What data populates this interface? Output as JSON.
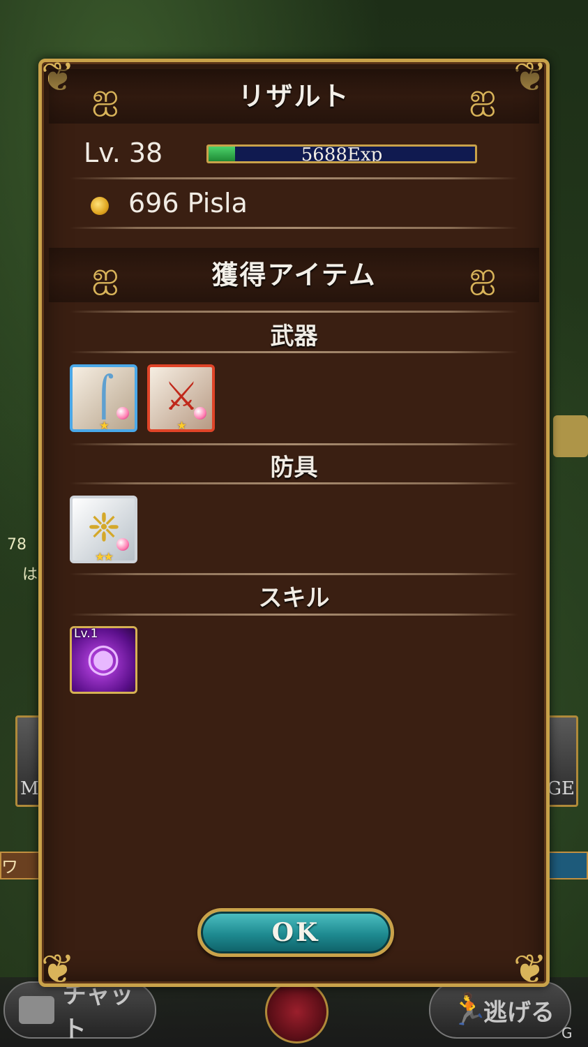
{
  "background": {
    "left_hp_value": "78",
    "left_hp_char": "は",
    "left_side_text": "M",
    "right_side_text": "GE",
    "left_bar_text": "ワ"
  },
  "dialog": {
    "title": "リザルト",
    "level_label": "Lv. 38",
    "exp_text": "5688Exp",
    "exp_progress_fraction": 0.1,
    "currency_text": "696 Pisla",
    "items_header": "獲得アイテム",
    "sections": {
      "weapons": "武器",
      "armor": "防具",
      "skills": "スキル"
    },
    "skill_tile_level": "Lv.1",
    "weapon_items": [
      {
        "icon": "scythe-icon",
        "rarity": "★"
      },
      {
        "icon": "sword-icon",
        "rarity": "★"
      }
    ],
    "armor_items": [
      {
        "icon": "winged-crest-icon",
        "rarity": "★★"
      }
    ],
    "ok_label": "OK"
  },
  "bottom_bar": {
    "chat_label": "チャット",
    "flee_label": "逃げる"
  },
  "colors": {
    "panel_bg": "#3a1f12",
    "gold_border": "#c9a24a",
    "exp_fill": "#1e8a35",
    "ok_button": "#1e8a90"
  }
}
